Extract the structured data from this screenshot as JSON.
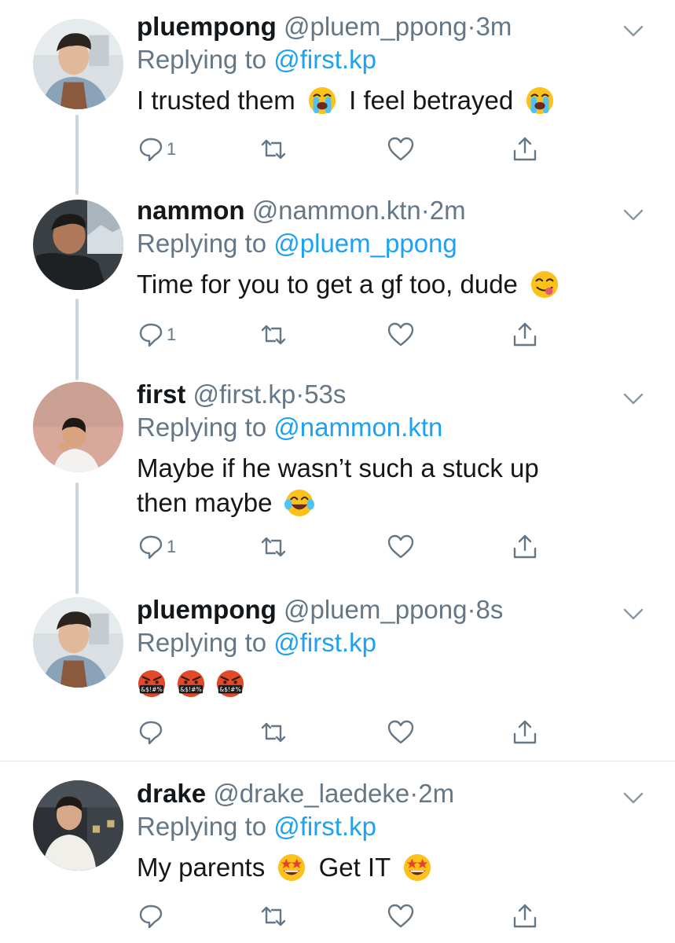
{
  "tweets": [
    {
      "name": "pluempong",
      "handle": "@pluem_ppong",
      "dot": "·",
      "time": "3m",
      "replying_prefix": "Replying to ",
      "replying_to": "@first.kp",
      "text_parts": [
        "I trusted them",
        "I feel betrayed"
      ],
      "emojis": [
        "crying-face",
        "crying-face"
      ],
      "reply_count": "1"
    },
    {
      "name": "nammon",
      "handle": "@nammon.ktn",
      "dot": "·",
      "time": "2m",
      "replying_prefix": "Replying to ",
      "replying_to": "@pluem_ppong",
      "text_parts": [
        "Time for you to get a gf too, dude"
      ],
      "emojis": [
        "yum-face"
      ],
      "reply_count": "1"
    },
    {
      "name": "first",
      "handle": "@first.kp",
      "dot": "·",
      "time": "53s",
      "replying_prefix": "Replying to ",
      "replying_to": "@nammon.ktn",
      "text_parts": [
        "Maybe if he wasn’t such a stuck up",
        "then maybe"
      ],
      "emojis": [
        "tears-of-joy-face"
      ],
      "reply_count": "1"
    },
    {
      "name": "pluempong",
      "handle": "@pluem_ppong",
      "dot": "·",
      "time": "8s",
      "replying_prefix": "Replying to ",
      "replying_to": "@first.kp",
      "text_parts": [],
      "emojis": [
        "cursing-face",
        "cursing-face",
        "cursing-face"
      ],
      "reply_count": ""
    },
    {
      "name": "drake",
      "handle": "@drake_laedeke",
      "dot": "·",
      "time": "2m",
      "replying_prefix": "Replying to ",
      "replying_to": "@first.kp",
      "text_parts": [
        "My parents",
        "Get IT"
      ],
      "emojis": [
        "star-struck-face",
        "star-struck-face"
      ],
      "reply_count": ""
    }
  ],
  "cursing_symbols": "&$!#%",
  "colors": {
    "link": "#1da1f2",
    "muted": "#657786",
    "text": "#14171a",
    "thread_line": "#cdd6dd",
    "divider": "#e1e8ed"
  },
  "icons": {
    "reply": "reply-icon",
    "retweet": "retweet-icon",
    "like": "like-icon",
    "share": "share-icon",
    "menu": "chevron-down-icon"
  }
}
